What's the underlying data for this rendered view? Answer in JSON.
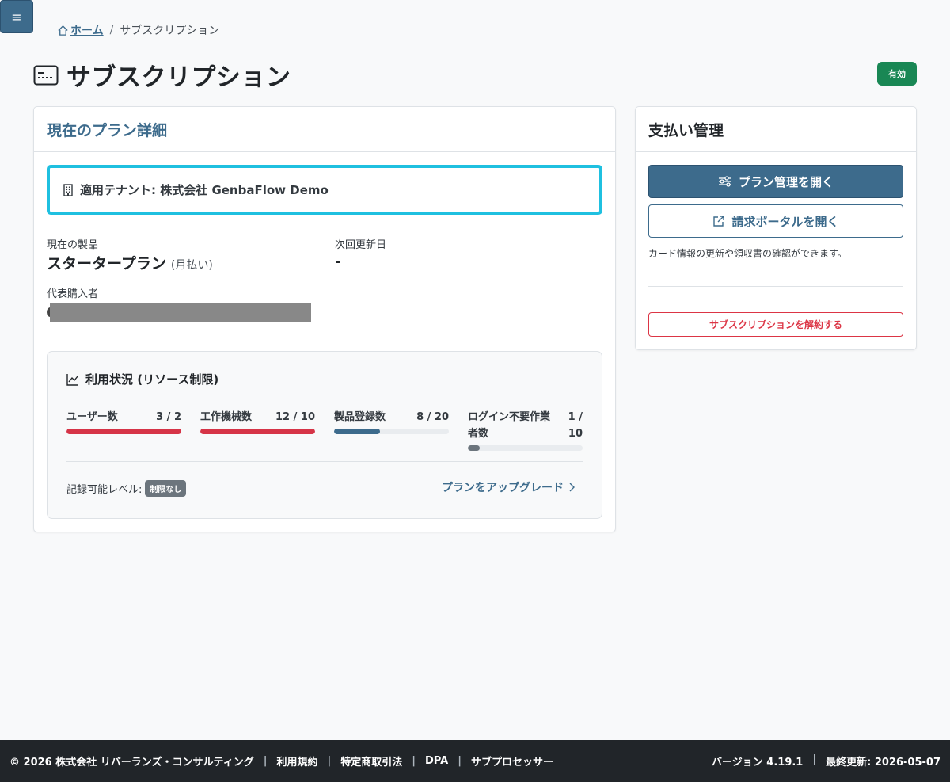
{
  "menu_toggle": {
    "glyph": "≡"
  },
  "breadcrumb": {
    "home": "ホーム",
    "separator": "/",
    "current": "サブスクリプション"
  },
  "page": {
    "title": "サブスクリプション",
    "status": "有効"
  },
  "plan_card": {
    "header": "現在のプラン詳細",
    "tenant": "適用テナント: 株式会社 GenbaFlow Demo",
    "product_label": "現在の製品",
    "product_value": "スタータープラン",
    "billing_cycle": "(月払い)",
    "renewal_label": "次回更新日",
    "renewal_value": "-",
    "purchaser_label": "代表購入者",
    "usage": {
      "title": "利用状況 (リソース制限)",
      "metrics": [
        {
          "label": "ユーザー数",
          "value": "3 / 2",
          "fill": 1.0,
          "color": "#d63447"
        },
        {
          "label": "工作機械数",
          "value": "12 / 10",
          "fill": 1.0,
          "color": "#d63447"
        },
        {
          "label": "製品登録数",
          "value": "8 / 20",
          "fill": 0.4,
          "color": "#3d6b8c"
        },
        {
          "label": "ログイン不要作業者数",
          "value": "1 / 10",
          "fill": 0.1,
          "color": "#6c757d"
        }
      ],
      "record_level_label": "記録可能レベル:",
      "record_level_value": "制限なし",
      "upgrade_link": "プランをアップグレード"
    }
  },
  "pay_card": {
    "header": "支払い管理",
    "open_plan": "プラン管理を開く",
    "open_portal": "請求ポータルを開く",
    "note": "カード情報の更新や領収書の確認ができます。",
    "cancel": "サブスクリプションを解約する"
  },
  "footer": {
    "copyright": "© 2026 株式会社 リバーランズ・コンサルティング",
    "links": [
      "利用規約",
      "特定商取引法",
      "DPA",
      "サブプロセッサー"
    ],
    "version": "バージョン 4.19.1",
    "updated": "最終更新: 2026-05-07"
  },
  "colors": {
    "primary": "#3d6b8c",
    "success": "#198754",
    "danger": "#dc3545",
    "focus": "#1fc0e0"
  }
}
